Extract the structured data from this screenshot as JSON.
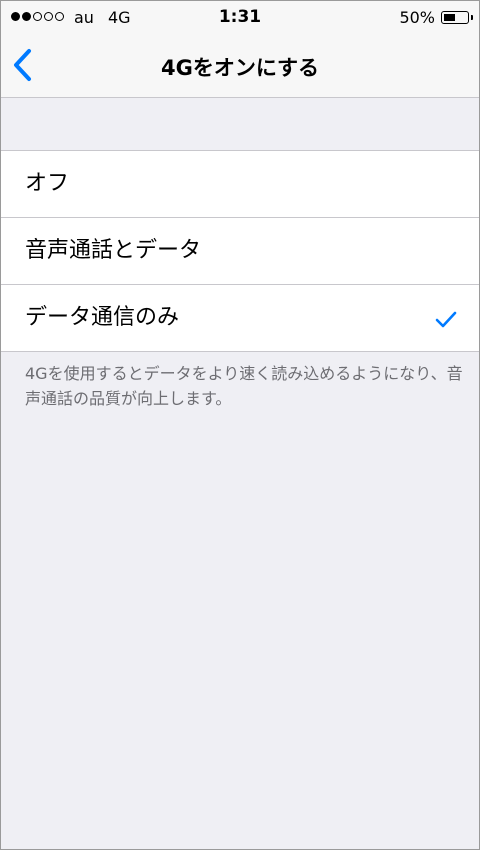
{
  "status_bar": {
    "carrier": "au",
    "network": "4G",
    "time": "1:31",
    "battery": "50%",
    "battery_level": 0.5,
    "signal_strength": 2,
    "signal_max": 5
  },
  "nav": {
    "title": "4Gをオンにする",
    "back_icon": "chevron-left-icon",
    "accent_color": "#007aff"
  },
  "options": [
    {
      "label": "オフ",
      "selected": false
    },
    {
      "label": "音声通話とデータ",
      "selected": false
    },
    {
      "label": "データ通信のみ",
      "selected": true
    }
  ],
  "footer": {
    "note": "4Gを使用するとデータをより速く読み込めるようになり、音声通話の品質が向上します。"
  }
}
